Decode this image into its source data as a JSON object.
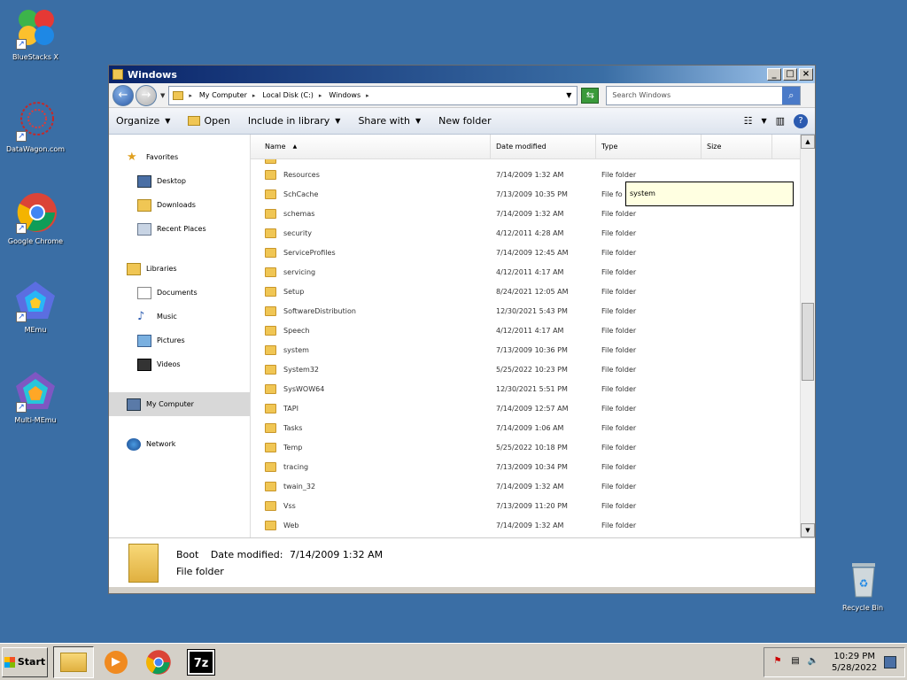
{
  "desktop": {
    "icons": [
      {
        "label": "BlueStacks X"
      },
      {
        "label": "DataWagon.com"
      },
      {
        "label": "Google Chrome"
      },
      {
        "label": "MEmu"
      },
      {
        "label": "Multi-MEmu"
      },
      {
        "label": "Recycle Bin"
      }
    ]
  },
  "window": {
    "title": "Windows",
    "buttons": {
      "minimize": "_",
      "maximize": "□",
      "close": "×"
    },
    "address": {
      "crumbs": [
        "My Computer",
        "Local Disk (C:)",
        "Windows"
      ]
    },
    "search_placeholder": "Search Windows",
    "toolbar": {
      "organize": "Organize",
      "open": "Open",
      "include": "Include in library",
      "share": "Share with",
      "new_folder": "New folder"
    },
    "nav": {
      "favorites": "Favorites",
      "desktop": "Desktop",
      "downloads": "Downloads",
      "recent": "Recent Places",
      "libraries": "Libraries",
      "documents": "Documents",
      "music": "Music",
      "pictures": "Pictures",
      "videos": "Videos",
      "computer": "My Computer",
      "network": "Network"
    },
    "columns": {
      "name": "Name",
      "date": "Date modified",
      "type": "Type",
      "size": "Size"
    },
    "rows": [
      {
        "name": "Resources",
        "date": "7/14/2009 1:32 AM",
        "type": "File folder"
      },
      {
        "name": "SchCache",
        "date": "7/13/2009 10:35 PM",
        "type": "File fo"
      },
      {
        "name": "schemas",
        "date": "7/14/2009 1:32 AM",
        "type": "File folder"
      },
      {
        "name": "security",
        "date": "4/12/2011 4:28 AM",
        "type": "File folder"
      },
      {
        "name": "ServiceProfiles",
        "date": "7/14/2009 12:45 AM",
        "type": "File folder"
      },
      {
        "name": "servicing",
        "date": "4/12/2011 4:17 AM",
        "type": "File folder"
      },
      {
        "name": "Setup",
        "date": "8/24/2021 12:05 AM",
        "type": "File folder"
      },
      {
        "name": "SoftwareDistribution",
        "date": "12/30/2021 5:43 PM",
        "type": "File folder"
      },
      {
        "name": "Speech",
        "date": "4/12/2011 4:17 AM",
        "type": "File folder"
      },
      {
        "name": "system",
        "date": "7/13/2009 10:36 PM",
        "type": "File folder"
      },
      {
        "name": "System32",
        "date": "5/25/2022 10:23 PM",
        "type": "File folder"
      },
      {
        "name": "SysWOW64",
        "date": "12/30/2021 5:51 PM",
        "type": "File folder"
      },
      {
        "name": "TAPI",
        "date": "7/14/2009 12:57 AM",
        "type": "File folder"
      },
      {
        "name": "Tasks",
        "date": "7/14/2009 1:06 AM",
        "type": "File folder"
      },
      {
        "name": "Temp",
        "date": "5/25/2022 10:18 PM",
        "type": "File folder"
      },
      {
        "name": "tracing",
        "date": "7/13/2009 10:34 PM",
        "type": "File folder"
      },
      {
        "name": "twain_32",
        "date": "7/14/2009 1:32 AM",
        "type": "File folder"
      },
      {
        "name": "Vss",
        "date": "7/13/2009 11:20 PM",
        "type": "File folder"
      },
      {
        "name": "Web",
        "date": "7/14/2009 1:32 AM",
        "type": "File folder"
      }
    ],
    "tooltip": "system",
    "details": {
      "name": "Boot",
      "date_label": "Date modified:",
      "date": "7/14/2009 1:32 AM",
      "type": "File folder"
    }
  },
  "taskbar": {
    "start": "Start",
    "time": "10:29 PM",
    "date": "5/28/2022"
  }
}
